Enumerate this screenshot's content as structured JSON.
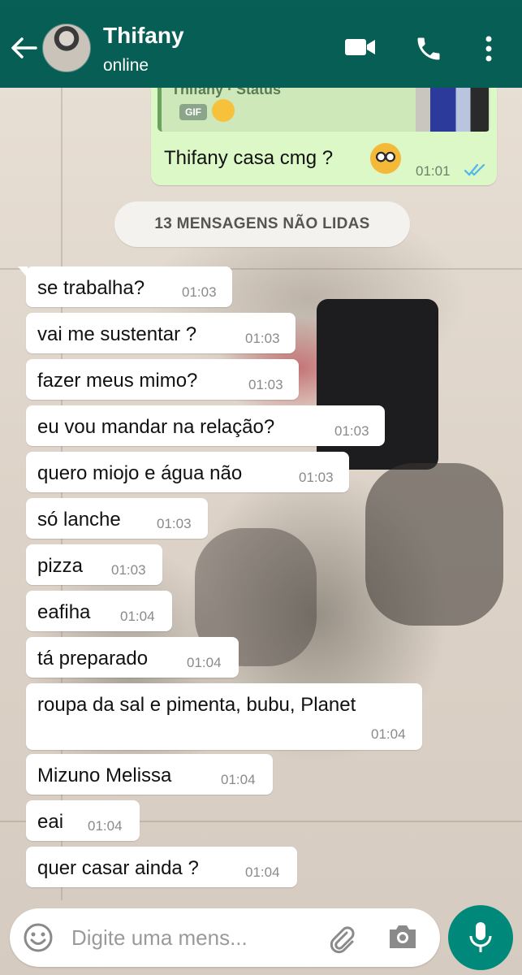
{
  "header": {
    "contact_name": "Thifany",
    "status": "online",
    "icons": [
      "back-arrow-icon",
      "video-call-icon",
      "phone-icon",
      "more-vert-icon"
    ]
  },
  "sent_message": {
    "quoted_badge": "GIF",
    "text": "Thifany casa cmg ?",
    "time": "01:01",
    "status_icon": "double-check-read-icon"
  },
  "unread_banner": "13 MENSAGENS NÃO LIDAS",
  "messages": [
    {
      "text": "se trabalha?",
      "time": "01:03"
    },
    {
      "text": "vai me sustentar ?",
      "time": "01:03"
    },
    {
      "text": "fazer meus mimo?",
      "time": "01:03"
    },
    {
      "text": "eu vou mandar na relação?",
      "time": "01:03"
    },
    {
      "text": "quero miojo e água não",
      "time": "01:03"
    },
    {
      "text": "só lanche",
      "time": "01:03"
    },
    {
      "text": "pizza",
      "time": "01:03"
    },
    {
      "text": "eafiha",
      "time": "01:04"
    },
    {
      "text": "tá preparado",
      "time": "01:04"
    },
    {
      "text": "roupa da sal e pimenta, bubu, Planet",
      "time": "01:04"
    },
    {
      "text": "Mizuno Melissa",
      "time": "01:04"
    },
    {
      "text": "eai",
      "time": "01:04"
    },
    {
      "text": "quer casar ainda ?",
      "time": "01:04"
    }
  ],
  "composer": {
    "placeholder": "Digite uma mens...",
    "icons": [
      "emoji-icon",
      "attach-clip-icon",
      "camera-icon",
      "mic-icon"
    ]
  },
  "colors": {
    "header": "#075e54",
    "sent_bubble": "#dcf8c6",
    "mic_button": "#00897b",
    "read_ticks": "#4fb6ec"
  }
}
